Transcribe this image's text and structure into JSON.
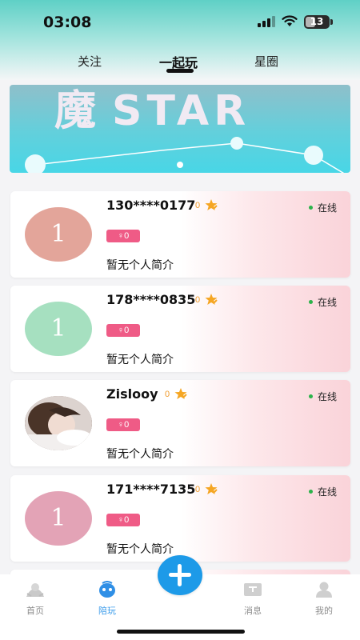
{
  "status_bar": {
    "time": "03:08",
    "battery": "13"
  },
  "tabs": [
    {
      "label": "关注"
    },
    {
      "label": "一起玩"
    },
    {
      "label": "星圈"
    }
  ],
  "banner": {
    "title_cjk": "魔",
    "title_latin": "STAR"
  },
  "users": [
    {
      "name": "130****0177",
      "score": "0",
      "avatar_text": "1",
      "avatar_color": "#e3a59a",
      "gender": "♀0",
      "bio": "暂无个人简介",
      "status": "在线"
    },
    {
      "name": "178****0835",
      "score": "0",
      "avatar_text": "1",
      "avatar_color": "#a6e0c0",
      "gender": "♀0",
      "bio": "暂无个人简介",
      "status": "在线"
    },
    {
      "name": "Zislooy",
      "score": "0",
      "avatar_text": "",
      "avatar_color": "",
      "gender": "♀0",
      "bio": "暂无个人简介",
      "status": "在线"
    },
    {
      "name": "171****7135",
      "score": "0",
      "avatar_text": "1",
      "avatar_color": "#e3a3b6",
      "gender": "♀0",
      "bio": "暂无个人简介",
      "status": "在线"
    }
  ],
  "bottom_nav": [
    {
      "label": "首页",
      "icon": "home-icon"
    },
    {
      "label": "陪玩",
      "icon": "robot-icon"
    },
    {
      "label": "消息",
      "icon": "message-icon"
    },
    {
      "label": "我的",
      "icon": "profile-icon"
    }
  ],
  "colors": {
    "accent": "#1d9ae8",
    "gender_badge": "#ef5b86",
    "online_dot": "#2bb34a"
  }
}
